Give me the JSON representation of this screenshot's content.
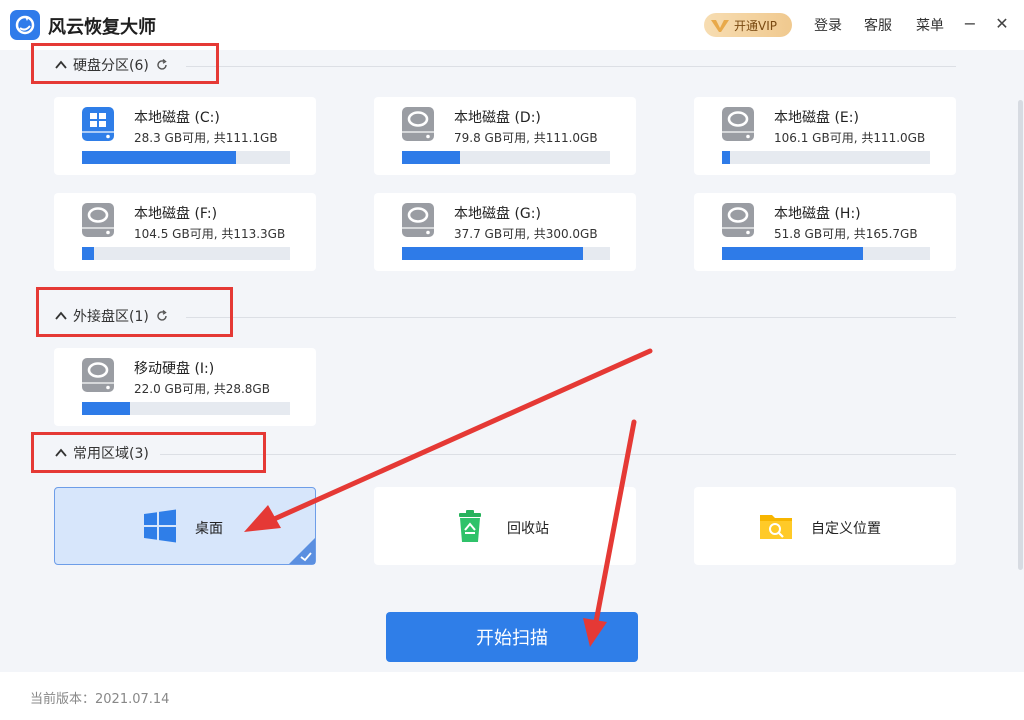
{
  "app": {
    "title": "风云恢复大师"
  },
  "topbar": {
    "vip_label": "开通VIP",
    "login": "登录",
    "service": "客服",
    "menu": "菜单",
    "minimize": "−",
    "close": "✕"
  },
  "sections": {
    "partitions": {
      "label": "硬盘分区(6)"
    },
    "external": {
      "label": "外接盘区(1)"
    },
    "common": {
      "label": "常用区域(3)"
    }
  },
  "drives": [
    {
      "name": "本地磁盘 (C:)",
      "size": "28.3 GB可用, 共111.1GB",
      "used_fraction": 0.74,
      "system": true
    },
    {
      "name": "本地磁盘 (D:)",
      "size": "79.8 GB可用, 共111.0GB",
      "used_fraction": 0.28,
      "system": false
    },
    {
      "name": "本地磁盘 (E:)",
      "size": "106.1 GB可用, 共111.0GB",
      "used_fraction": 0.04,
      "system": false
    },
    {
      "name": "本地磁盘 (F:)",
      "size": "104.5 GB可用, 共113.3GB",
      "used_fraction": 0.06,
      "system": false
    },
    {
      "name": "本地磁盘 (G:)",
      "size": "37.7 GB可用, 共300.0GB",
      "used_fraction": 0.87,
      "system": false
    },
    {
      "name": "本地磁盘 (H:)",
      "size": "51.8 GB可用, 共165.7GB",
      "used_fraction": 0.68,
      "system": false
    }
  ],
  "external_drives": [
    {
      "name": "移动硬盘 (I:)",
      "size": "22.0 GB可用, 共28.8GB",
      "used_fraction": 0.23
    }
  ],
  "locations": [
    {
      "label": "桌面",
      "icon": "windows-icon",
      "selected": true
    },
    {
      "label": "回收站",
      "icon": "recycle-bin-icon",
      "selected": false
    },
    {
      "label": "自定义位置",
      "icon": "folder-search-icon",
      "selected": false
    }
  ],
  "actions": {
    "scan": "开始扫描"
  },
  "footer": {
    "version": "当前版本：2021.07.14"
  },
  "colors": {
    "accent": "#2f7ee8",
    "annotation": "#e53935",
    "vip": "#f0c98f"
  }
}
